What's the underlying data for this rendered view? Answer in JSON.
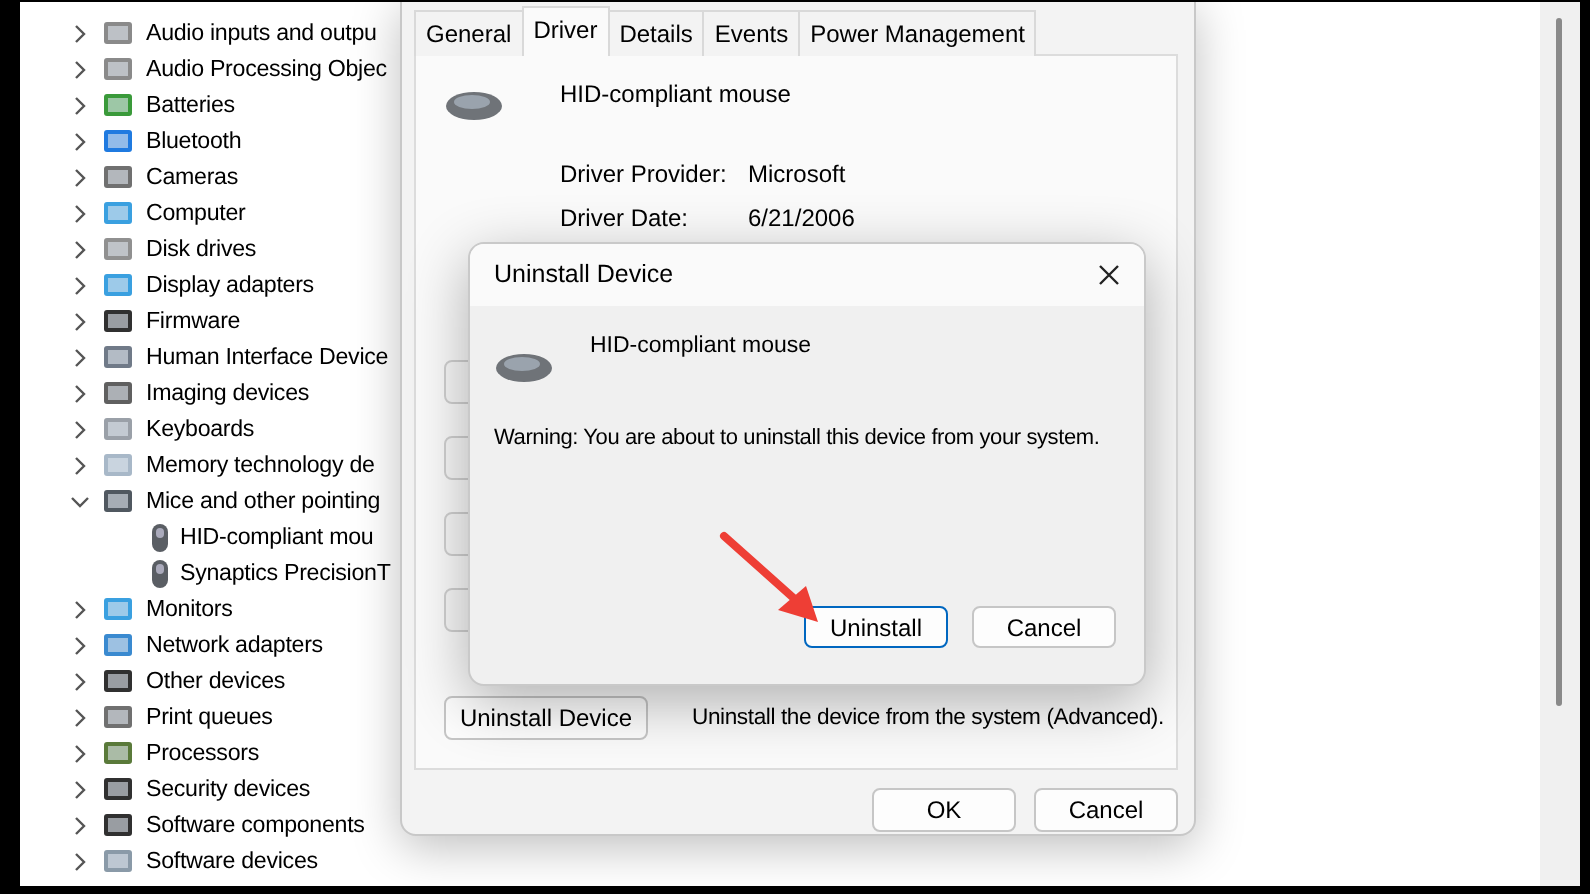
{
  "device_tree": {
    "items": [
      {
        "label": "Audio inputs and outpu",
        "expanded": false
      },
      {
        "label": "Audio Processing Objec",
        "expanded": false
      },
      {
        "label": "Batteries",
        "expanded": false
      },
      {
        "label": "Bluetooth",
        "expanded": false
      },
      {
        "label": "Cameras",
        "expanded": false
      },
      {
        "label": "Computer",
        "expanded": false
      },
      {
        "label": "Disk drives",
        "expanded": false
      },
      {
        "label": "Display adapters",
        "expanded": false
      },
      {
        "label": "Firmware",
        "expanded": false
      },
      {
        "label": "Human Interface Device",
        "expanded": false
      },
      {
        "label": "Imaging devices",
        "expanded": false
      },
      {
        "label": "Keyboards",
        "expanded": false
      },
      {
        "label": "Memory technology de",
        "expanded": false
      },
      {
        "label": "Mice and other pointing",
        "expanded": true,
        "children": [
          {
            "label": "HID-compliant mou"
          },
          {
            "label": "Synaptics PrecisionT"
          }
        ]
      },
      {
        "label": "Monitors",
        "expanded": false
      },
      {
        "label": "Network adapters",
        "expanded": false
      },
      {
        "label": "Other devices",
        "expanded": false
      },
      {
        "label": "Print queues",
        "expanded": false
      },
      {
        "label": "Processors",
        "expanded": false
      },
      {
        "label": "Security devices",
        "expanded": false
      },
      {
        "label": "Software components",
        "expanded": false
      },
      {
        "label": "Software devices",
        "expanded": false
      }
    ]
  },
  "properties_dialog": {
    "tabs": [
      {
        "label": "General",
        "selected": false
      },
      {
        "label": "Driver",
        "selected": true
      },
      {
        "label": "Details",
        "selected": false
      },
      {
        "label": "Events",
        "selected": false
      },
      {
        "label": "Power Management",
        "selected": false
      }
    ],
    "device_name": "HID-compliant mouse",
    "fields": [
      {
        "label": "Driver Provider:",
        "value": "Microsoft"
      },
      {
        "label": "Driver Date:",
        "value": "6/21/2006"
      }
    ],
    "uninstall_button": "Uninstall Device",
    "uninstall_description": "Uninstall the device from the system (Advanced).",
    "buttons": [
      "OK",
      "Cancel"
    ]
  },
  "uninstall_dialog": {
    "title": "Uninstall Device",
    "device_name": "HID-compliant mouse",
    "warning": "Warning: You are about to uninstall this device from your system.",
    "buttons": [
      {
        "label": "Uninstall",
        "focused": true
      },
      {
        "label": "Cancel",
        "focused": false
      }
    ]
  }
}
